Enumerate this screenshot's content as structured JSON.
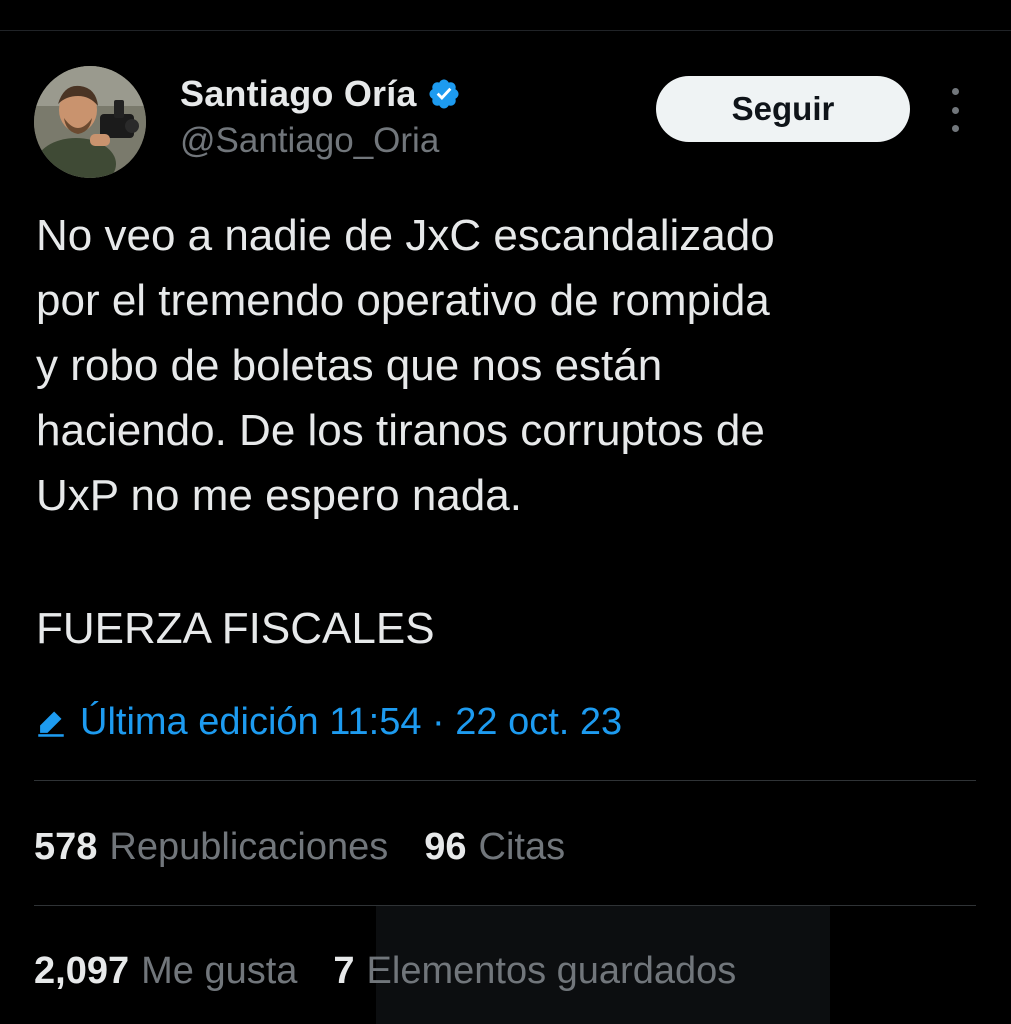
{
  "author": {
    "display_name": "Santiago Oría",
    "handle": "@Santiago_Oria",
    "verified": true,
    "avatar_icon": "profile-photo-man-with-camera"
  },
  "header": {
    "follow_label": "Seguir",
    "more_icon": "vertical-ellipsis-icon"
  },
  "tweet": {
    "lines": [
      "No veo a nadie de JxC escandalizado",
      "por el tremendo operativo de rompida",
      "y robo de boletas que nos están",
      "haciendo. De los tiranos corruptos de",
      "UxP no me espero nada."
    ],
    "closing": "FUERZA FISCALES"
  },
  "edit_info": {
    "icon": "pencil-icon",
    "label": "Última edición 11:54 · 22 oct. 23"
  },
  "stats": {
    "reposts": {
      "value": "578",
      "label": "Republicaciones"
    },
    "quotes": {
      "value": "96",
      "label": "Citas"
    },
    "likes": {
      "value": "2,097",
      "label": "Me gusta"
    },
    "bookmarks": {
      "value": "7",
      "label": "Elementos guardados"
    }
  },
  "colors": {
    "background": "#000000",
    "text_primary": "#e7e9ea",
    "text_secondary": "#71767b",
    "accent": "#1d9bf0",
    "divider": "#2f3336",
    "follow_button_bg": "#eff3f4"
  }
}
